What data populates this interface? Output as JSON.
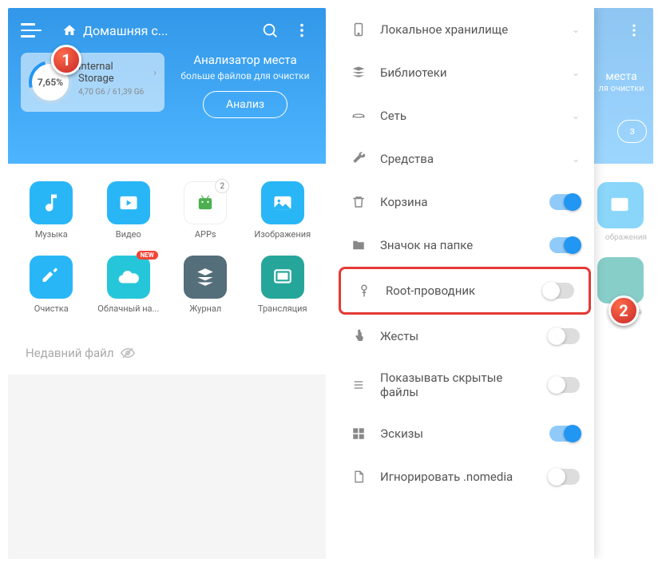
{
  "left": {
    "breadcrumb": "Домашняя с...",
    "storage": {
      "percent": "7,65%",
      "name": "Internal Storage",
      "size": "4,70 G6 / 61,39 G6"
    },
    "analyzer": {
      "title": "Анализатор места",
      "sub": "больше файлов для очистки",
      "btn": "Анализ"
    },
    "tiles": {
      "music": "Музыка",
      "video": "Видео",
      "apps": "APPs",
      "apps_badge": "2",
      "images": "Изображения",
      "clean": "Очистка",
      "cloud": "Облачный на...",
      "cloud_badge": "NEW",
      "log": "Журнал",
      "cast": "Трансляция"
    },
    "recent": "Недавний файл"
  },
  "right": {
    "bg": {
      "title": "места",
      "sub": "ля очистки",
      "btn": "з",
      "tile1": "ображения",
      "tile2": "сляция"
    },
    "items": {
      "local": "Локальное хранилище",
      "libs": "Библиотеки",
      "net": "Сеть",
      "tools": "Средства",
      "trash": "Корзина",
      "folder_icon": "Значок на папке",
      "root": "Root-проводник",
      "gestures": "Жесты",
      "hidden": "Показывать скрытые файлы",
      "thumbs": "Эскизы",
      "nomedia": "Игнорировать .nomedia"
    }
  },
  "markers": {
    "m1": "1",
    "m2": "2"
  }
}
